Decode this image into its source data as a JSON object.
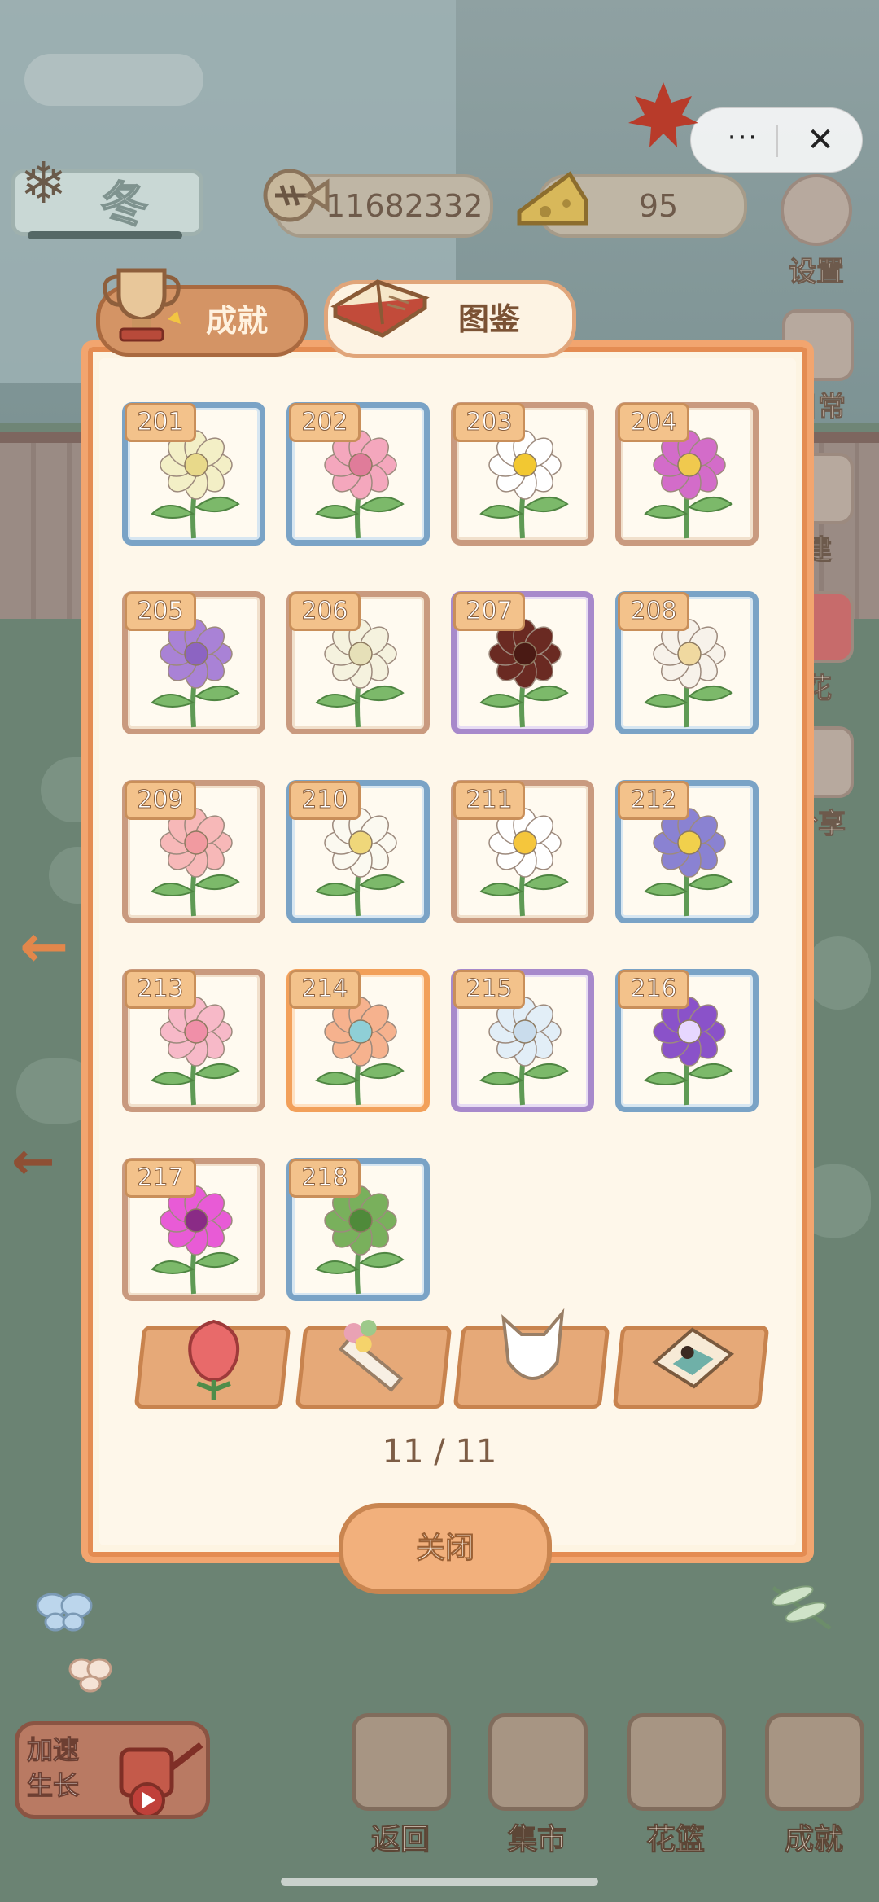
{
  "hud": {
    "more_label": "···",
    "close_label": "✕",
    "season_label": "冬",
    "fish_count": "11682332",
    "cheese_count": "95"
  },
  "side_menu": [
    {
      "label": "设置",
      "icon": "gear-icon"
    },
    {
      "label": "日常",
      "icon": "scroll-icon"
    },
    {
      "label": "建",
      "icon": "hammer-icon"
    },
    {
      "label": "花",
      "icon": "rose-icon"
    },
    {
      "label": "分享",
      "icon": "share-icon"
    }
  ],
  "tabs": {
    "achievement_label": "成就",
    "encyclopedia_label": "图鉴"
  },
  "flowers": [
    {
      "id": "201",
      "frame": "#7aa3c6",
      "petal": "#f3efc6",
      "center": "#e8d98a"
    },
    {
      "id": "202",
      "frame": "#7aa3c6",
      "petal": "#f4a7bd",
      "center": "#e07c9a"
    },
    {
      "id": "203",
      "frame": "#c99a7f",
      "petal": "#ffffff",
      "center": "#f2c832"
    },
    {
      "id": "204",
      "frame": "#c99a7f",
      "petal": "#d36cc9",
      "center": "#f0c94e"
    },
    {
      "id": "205",
      "frame": "#c99a7f",
      "petal": "#a982d6",
      "center": "#8c64c2"
    },
    {
      "id": "206",
      "frame": "#c99a7f",
      "petal": "#f5f2de",
      "center": "#e6e0b8"
    },
    {
      "id": "207",
      "frame": "#a789cb",
      "petal": "#6a2a22",
      "center": "#4a1a14"
    },
    {
      "id": "208",
      "frame": "#7aa3c6",
      "petal": "#f7f2ea",
      "center": "#f0d9a0"
    },
    {
      "id": "209",
      "frame": "#c99a7f",
      "petal": "#f7b8b8",
      "center": "#f19aa0"
    },
    {
      "id": "210",
      "frame": "#7aa3c6",
      "petal": "#fbf9f0",
      "center": "#efd77a"
    },
    {
      "id": "211",
      "frame": "#c99a7f",
      "petal": "#ffffff",
      "center": "#f5c63c"
    },
    {
      "id": "212",
      "frame": "#7aa3c6",
      "petal": "#8a82d2",
      "center": "#f1d04c"
    },
    {
      "id": "213",
      "frame": "#c99a7f",
      "petal": "#f7b9c8",
      "center": "#f08fa8"
    },
    {
      "id": "214",
      "frame": "#f2a05a",
      "petal": "#f6b28e",
      "center": "#8fcfd6"
    },
    {
      "id": "215",
      "frame": "#a789cb",
      "petal": "#e2eef7",
      "center": "#c9dcec"
    },
    {
      "id": "216",
      "frame": "#7aa3c6",
      "petal": "#8a52c9",
      "center": "#e7d7ff"
    },
    {
      "id": "217",
      "frame": "#c99a7f",
      "petal": "#e85bd6",
      "center": "#8a2b86"
    },
    {
      "id": "218",
      "frame": "#7aa3c6",
      "petal": "#79b05c",
      "center": "#4f8a3a"
    }
  ],
  "categories": [
    {
      "icon": "rose-bud-icon"
    },
    {
      "icon": "bouquet-icon"
    },
    {
      "icon": "vase-icon"
    },
    {
      "icon": "picture-icon"
    }
  ],
  "pager": {
    "text": "11 / 11"
  },
  "close_button": {
    "label": "关闭"
  },
  "bottom": {
    "speed_label": "加速生长",
    "nav": [
      {
        "label": "返回",
        "icon": "window-icon"
      },
      {
        "label": "集市",
        "icon": "stall-icon"
      },
      {
        "label": "花篮",
        "icon": "basket-icon"
      },
      {
        "label": "成就",
        "icon": "trophy-icon"
      }
    ]
  }
}
